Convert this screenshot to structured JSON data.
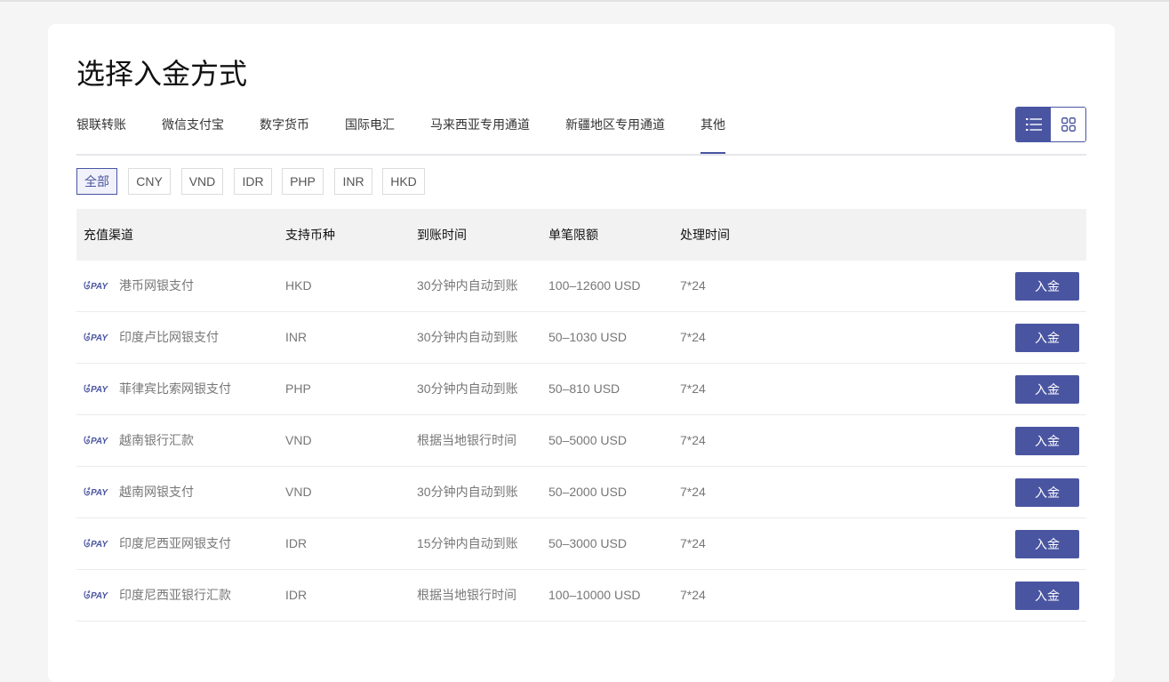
{
  "page": {
    "title": "选择入金方式"
  },
  "tabs": [
    {
      "label": "银联转账"
    },
    {
      "label": "微信支付宝"
    },
    {
      "label": "数字货币"
    },
    {
      "label": "国际电汇"
    },
    {
      "label": "马来西亚专用通道"
    },
    {
      "label": "新疆地区专用通道"
    },
    {
      "label": "其他",
      "active": true
    }
  ],
  "view_toggle": {
    "active": "list",
    "icons": [
      "list-icon",
      "grid-icon"
    ]
  },
  "currency_filters": [
    {
      "label": "全部",
      "active": true
    },
    {
      "label": "CNY"
    },
    {
      "label": "VND"
    },
    {
      "label": "IDR"
    },
    {
      "label": "PHP"
    },
    {
      "label": "INR"
    },
    {
      "label": "HKD"
    }
  ],
  "table": {
    "columns": [
      "充值渠道",
      "支持币种",
      "到账时间",
      "单笔限额",
      "处理时间"
    ],
    "logo_text": "PAY",
    "action_label": "入金",
    "rows": [
      {
        "channel": "港币网银支付",
        "currency": "HKD",
        "arrival": "30分钟内自动到账",
        "limit": "100–12600 USD",
        "processing": "7*24"
      },
      {
        "channel": "印度卢比网银支付",
        "currency": "INR",
        "arrival": "30分钟内自动到账",
        "limit": "50–1030 USD",
        "processing": "7*24"
      },
      {
        "channel": "菲律宾比索网银支付",
        "currency": "PHP",
        "arrival": "30分钟内自动到账",
        "limit": "50–810 USD",
        "processing": "7*24"
      },
      {
        "channel": "越南银行汇款",
        "currency": "VND",
        "arrival": "根据当地银行时间",
        "limit": "50–5000 USD",
        "processing": "7*24"
      },
      {
        "channel": "越南网银支付",
        "currency": "VND",
        "arrival": "30分钟内自动到账",
        "limit": "50–2000 USD",
        "processing": "7*24"
      },
      {
        "channel": "印度尼西亚网银支付",
        "currency": "IDR",
        "arrival": "15分钟内自动到账",
        "limit": "50–3000 USD",
        "processing": "7*24"
      },
      {
        "channel": "印度尼西亚银行汇款",
        "currency": "IDR",
        "arrival": "根据当地银行时间",
        "limit": "100–10000 USD",
        "processing": "7*24"
      }
    ]
  },
  "colors": {
    "accent": "#4a55a2",
    "page_background": "#f5f5f5",
    "header_background": "#f2f2f2"
  }
}
